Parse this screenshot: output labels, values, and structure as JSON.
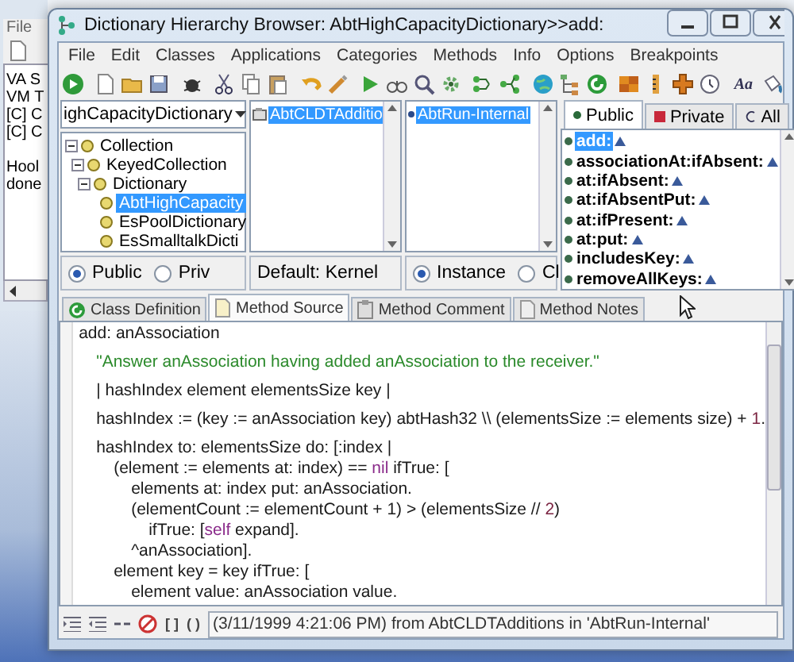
{
  "background_window": {
    "menu": [
      "File"
    ],
    "console_lines": [
      "VA S",
      "VM T",
      "[C] C",
      "[C] C",
      "Hool",
      "done"
    ]
  },
  "window": {
    "title": "Dictionary Hierarchy Browser: AbtHighCapacityDictionary>>add:"
  },
  "menu": [
    "File",
    "Edit",
    "Classes",
    "Applications",
    "Categories",
    "Methods",
    "Info",
    "Options",
    "Breakpoints"
  ],
  "toolbar": {
    "font_button": "Aa"
  },
  "class_pane": {
    "dropdown": "ighCapacityDictionary",
    "tree": [
      {
        "label": "Collection",
        "expanded": true,
        "selected": false,
        "children": [
          {
            "label": "KeyedCollection",
            "expanded": true,
            "selected": false,
            "children": [
              {
                "label": "Dictionary",
                "expanded": true,
                "selected": false,
                "children": [
                  {
                    "label": "AbtHighCapacity",
                    "selected": true
                  },
                  {
                    "label": "EsPoolDictionary",
                    "selected": false
                  },
                  {
                    "label": "EsSmalltalkDicti",
                    "selected": false
                  }
                ]
              }
            ]
          }
        ]
      }
    ]
  },
  "visibility": [
    {
      "label": "Public",
      "selected": true
    },
    {
      "label": "Priv",
      "selected": false
    }
  ],
  "application_pane": {
    "items": [
      {
        "label": "AbtCLDTAdditio",
        "selected": true
      }
    ],
    "footer": "Default: Kernel"
  },
  "category_pane": {
    "items": [
      {
        "label": "AbtRun-Internal",
        "selected": true
      }
    ]
  },
  "side": [
    {
      "label": "Instance",
      "selected": true
    },
    {
      "label": "Cl",
      "selected": false
    }
  ],
  "method_tabs": [
    {
      "label": "Public",
      "selected": true
    },
    {
      "label": "Private",
      "selected": false
    },
    {
      "label": "All",
      "selected": false
    }
  ],
  "methods": [
    {
      "label": "add:",
      "selected": true
    },
    {
      "label": "associationAt:ifAbsent:",
      "selected": false
    },
    {
      "label": "at:ifAbsent:",
      "selected": false
    },
    {
      "label": "at:ifAbsentPut:",
      "selected": false
    },
    {
      "label": "at:ifPresent:",
      "selected": false
    },
    {
      "label": "at:put:",
      "selected": false
    },
    {
      "label": "includesKey:",
      "selected": false
    },
    {
      "label": "removeAllKeys:",
      "selected": false
    }
  ],
  "editor_tabs": [
    {
      "label": "Class Definition",
      "selected": false
    },
    {
      "label": "Method Source",
      "selected": true
    },
    {
      "label": "Method Comment",
      "selected": false
    },
    {
      "label": "Method Notes",
      "selected": false
    }
  ],
  "code": [
    [
      {
        "segments": [
          {
            "kind": "plain",
            "text": "add: anAssociation"
          }
        ]
      }
    ],
    [
      {
        "segments": [
          {
            "kind": "comment",
            "text": "\t\"Answer anAssociation having added anAssociation to the receiver.\""
          }
        ]
      }
    ],
    [
      {
        "segments": [
          {
            "kind": "plain",
            "text": "\t| hashIndex element elementsSize key |"
          }
        ]
      }
    ],
    [
      {
        "segments": [
          {
            "kind": "plain",
            "text": "\thashIndex := (key := anAssociation key) abtHash32 \\\\ (elementsSize := elements size) + "
          },
          {
            "kind": "literal",
            "text": "1"
          },
          {
            "kind": "plain",
            "text": "."
          }
        ]
      }
    ],
    [
      {
        "segments": [
          {
            "kind": "plain",
            "text": "\thashIndex to: elementsSize do: [:index |"
          }
        ]
      },
      {
        "segments": [
          {
            "kind": "plain",
            "text": "\t\t(element := elements at: index) == "
          },
          {
            "kind": "keyword",
            "text": "nil"
          },
          {
            "kind": "plain",
            "text": " ifTrue: ["
          }
        ]
      },
      {
        "segments": [
          {
            "kind": "plain",
            "text": "\t\t\telements at: index put: anAssociation."
          }
        ]
      },
      {
        "segments": [
          {
            "kind": "plain",
            "text": "\t\t\t(elementCount := elementCount + 1) > (elementsSize // "
          },
          {
            "kind": "literal",
            "text": "2"
          },
          {
            "kind": "plain",
            "text": ")"
          }
        ]
      },
      {
        "segments": [
          {
            "kind": "plain",
            "text": "\t\t\t\tifTrue: ["
          },
          {
            "kind": "keyword",
            "text": "self"
          },
          {
            "kind": "plain",
            "text": " expand]."
          }
        ]
      },
      {
        "segments": [
          {
            "kind": "plain",
            "text": "\t\t\t^anAssociation]."
          }
        ]
      },
      {
        "segments": [
          {
            "kind": "plain",
            "text": "\t\telement key = key ifTrue: ["
          }
        ]
      },
      {
        "segments": [
          {
            "kind": "plain",
            "text": "\t\t\telement value: anAssociation value."
          }
        ]
      }
    ]
  ],
  "status_bar": {
    "bracket_button": "[ ]",
    "paren_button": "( )",
    "message": "(3/11/1999 4:21:06 PM) from AbtCLDTAdditions in 'AbtRun-Internal'"
  }
}
